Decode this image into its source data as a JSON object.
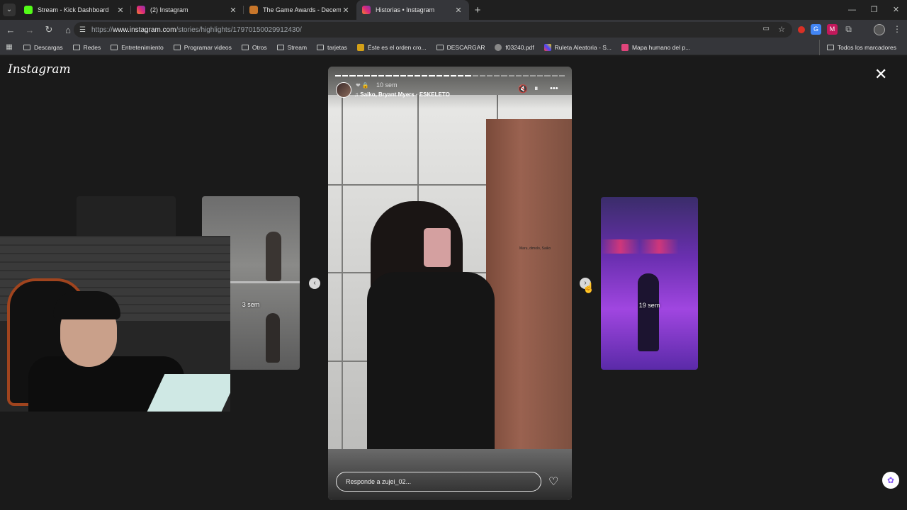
{
  "tabs": [
    {
      "title": "Stream - Kick Dashboard",
      "color": "#53fc18",
      "active": false
    },
    {
      "title": "(2) Instagram",
      "color": "#e1306c",
      "active": false
    },
    {
      "title": "The Game Awards - December",
      "color": "#c8762a",
      "active": false
    },
    {
      "title": "Historias • Instagram",
      "color": "#e1306c",
      "active": true
    }
  ],
  "new_tab": "+",
  "omnibox": {
    "url_prefix": "https://",
    "url_host": "www.instagram.com",
    "url_path": "/stories/highlights/17970150029912430/"
  },
  "bookmarks": [
    {
      "label": "Descargas"
    },
    {
      "label": "Redes"
    },
    {
      "label": "Entretenimiento"
    },
    {
      "label": "Programar videos"
    },
    {
      "label": "Otros"
    },
    {
      "label": "Stream"
    },
    {
      "label": "tarjetas"
    },
    {
      "label": "Éste es el orden cro..."
    },
    {
      "label": "DESCARGAR"
    },
    {
      "label": "f03240.pdf"
    },
    {
      "label": "Ruleta Aleatoria - S..."
    },
    {
      "label": "Mapa humano del p..."
    }
  ],
  "bookmarks_all": "Todos los marcadores",
  "page": {
    "logo": "Instagram",
    "left_story_age": "3 sem",
    "right_story_age": "19 sem",
    "story": {
      "time": "10 sem",
      "music": "Saiko, Bryant Myers · ESKELETO",
      "door_text": "Maru, dimolo, Saiko",
      "reply_placeholder": "Responde a zujei_02...",
      "progress_total": 32,
      "progress_done": 19
    }
  },
  "colors": {
    "accent": "#e1306c",
    "page_bg": "#1a1a1a"
  }
}
